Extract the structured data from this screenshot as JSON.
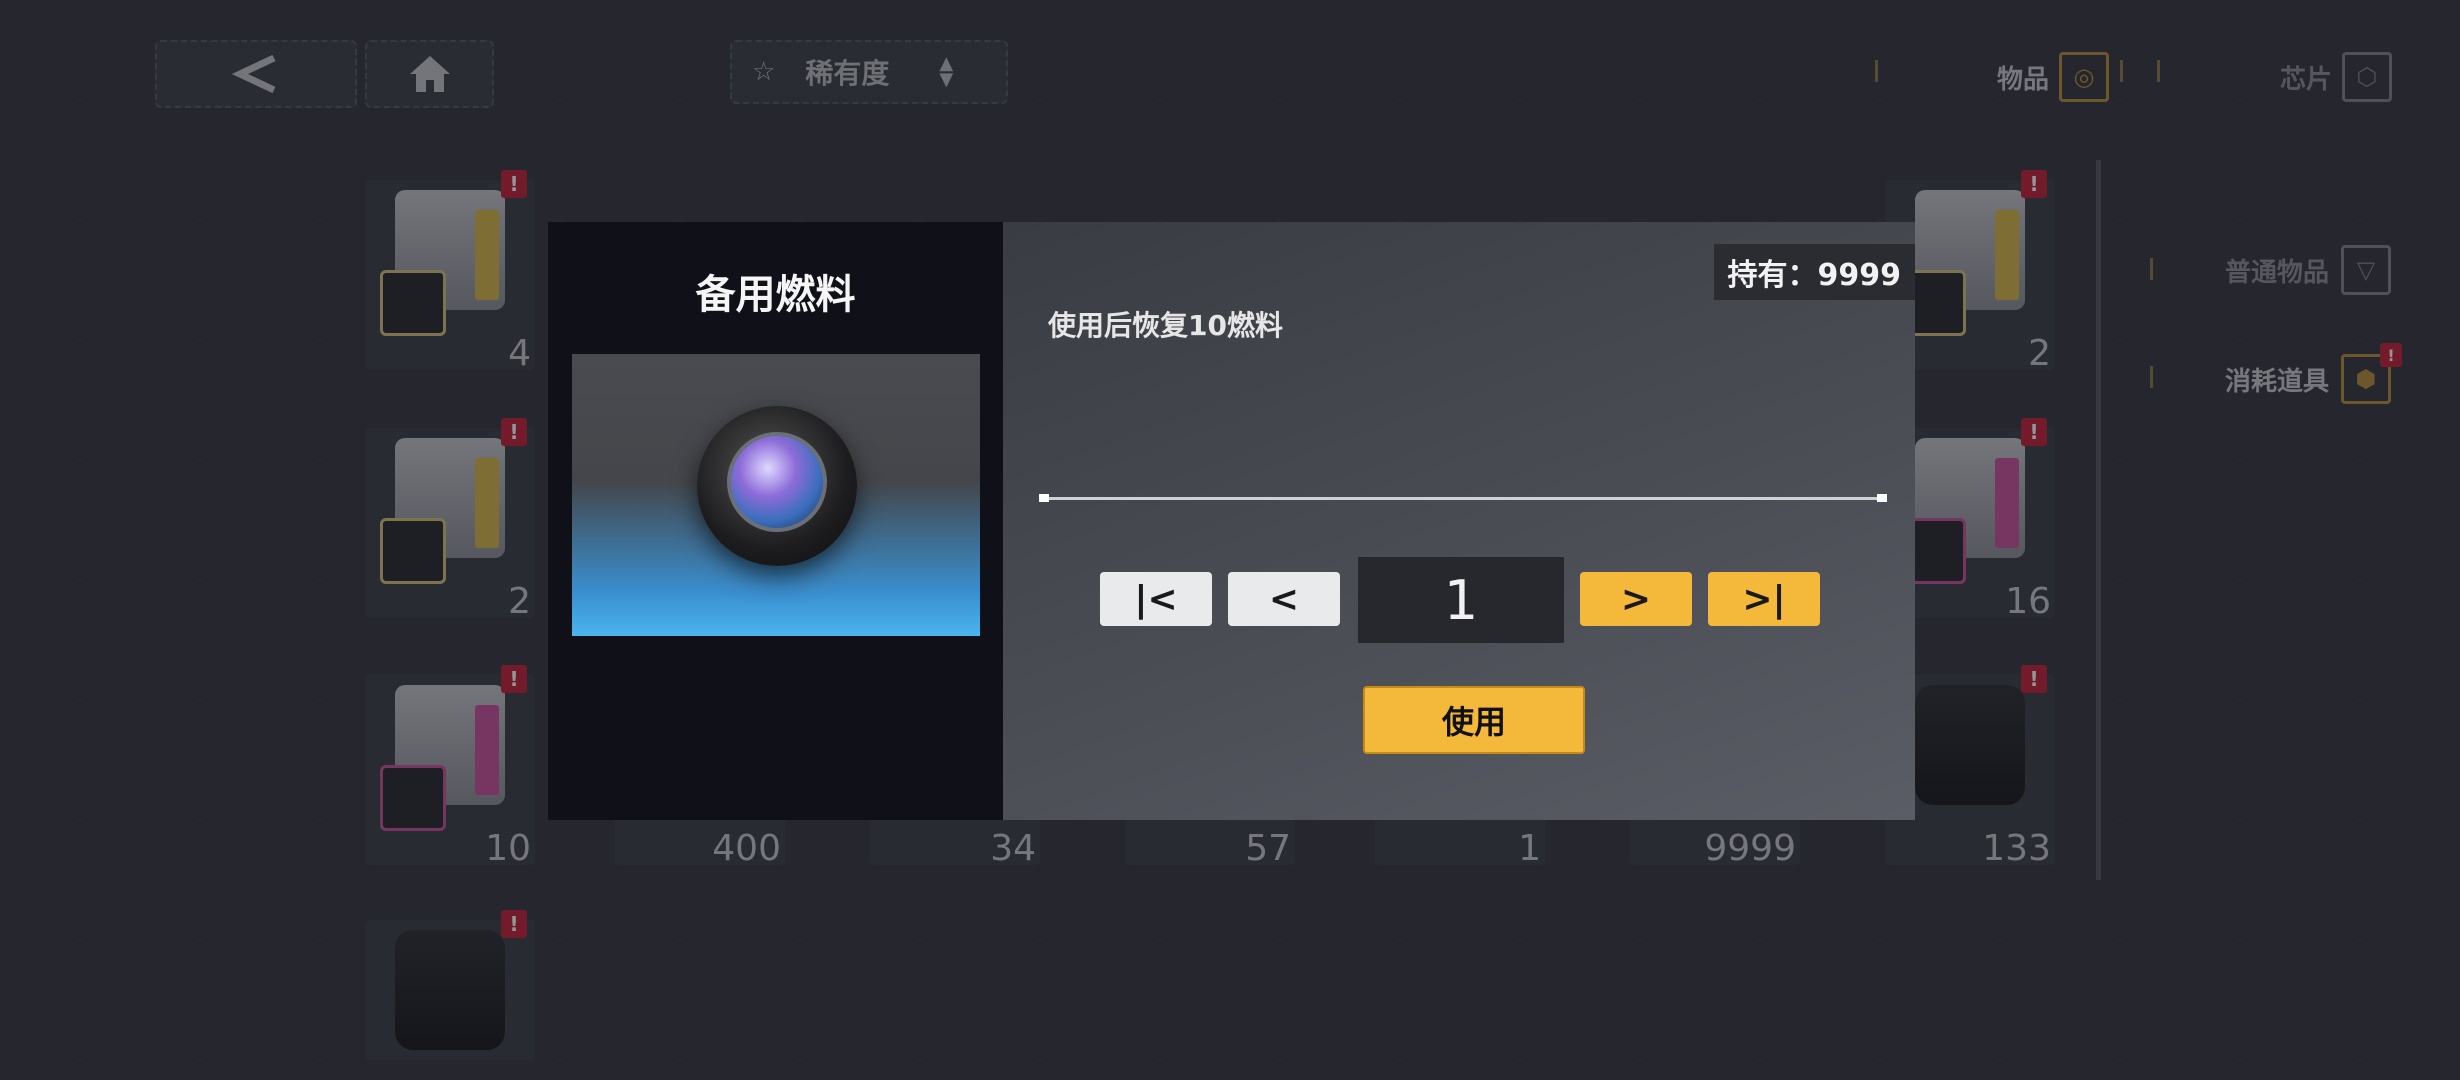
{
  "topbar": {
    "back_icon": "back-arrow-icon",
    "home_icon": "home-icon",
    "sort_label": "稀有度",
    "tabs": [
      {
        "label": "物品",
        "icon": "item-icon"
      },
      {
        "label": "芯片",
        "icon": "chip-icon"
      }
    ]
  },
  "sidebar": {
    "items": [
      {
        "label": "普通物品",
        "icon": "common-item-icon"
      },
      {
        "label": "消耗道具",
        "icon": "consumable-icon",
        "badge": "!"
      }
    ]
  },
  "inventory": {
    "counts": [
      "4",
      "2",
      "2",
      "16",
      "10",
      "400",
      "34",
      "57",
      "1",
      "9999",
      "133"
    ],
    "badge": "!"
  },
  "dialog": {
    "title": "备用燃料",
    "owned_label": "持有：9999",
    "description": "使用后恢复10燃料",
    "quantity": "1",
    "first_label": "|<",
    "prev_label": "<",
    "next_label": ">",
    "last_label": ">|",
    "use_label": "使用"
  }
}
